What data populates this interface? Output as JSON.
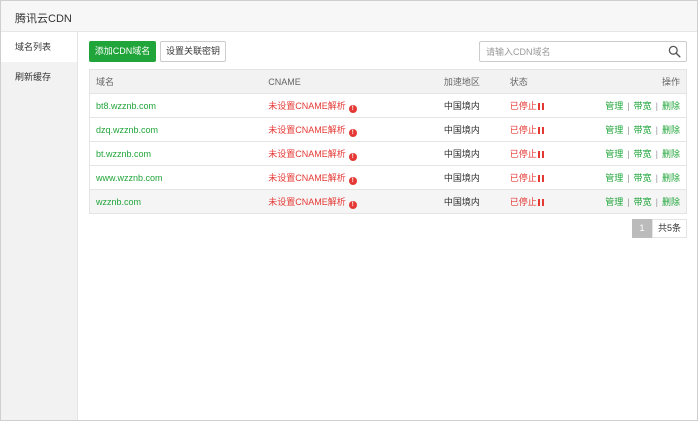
{
  "window": {
    "title": "腾讯云CDN"
  },
  "sidebar": {
    "items": [
      {
        "label": "域名列表"
      },
      {
        "label": "刷新缓存"
      }
    ]
  },
  "toolbar": {
    "add_button": "添加CDN域名",
    "key_button": "设置关联密钥",
    "search_placeholder": "请输入CDN域名",
    "search_icon": "search-icon"
  },
  "table": {
    "headers": {
      "domain": "域名",
      "cname": "CNAME",
      "region": "加速地区",
      "status": "状态",
      "ops": "操作"
    },
    "rows": [
      {
        "domain": "bt8.wzznb.com",
        "cname": "未设置CNAME解析",
        "region": "中国境内",
        "status": "已停止",
        "op_manage": "管理",
        "op_bandwidth": "带宽",
        "op_delete": "删除"
      },
      {
        "domain": "dzq.wzznb.com",
        "cname": "未设置CNAME解析",
        "region": "中国境内",
        "status": "已停止",
        "op_manage": "管理",
        "op_bandwidth": "带宽",
        "op_delete": "删除"
      },
      {
        "domain": "bt.wzznb.com",
        "cname": "未设置CNAME解析",
        "region": "中国境内",
        "status": "已停止",
        "op_manage": "管理",
        "op_bandwidth": "带宽",
        "op_delete": "删除"
      },
      {
        "domain": "www.wzznb.com",
        "cname": "未设置CNAME解析",
        "region": "中国境内",
        "status": "已停止",
        "op_manage": "管理",
        "op_bandwidth": "带宽",
        "op_delete": "删除"
      },
      {
        "domain": "wzznb.com",
        "cname": "未设置CNAME解析",
        "region": "中国境内",
        "status": "已停止",
        "op_manage": "管理",
        "op_bandwidth": "带宽",
        "op_delete": "删除"
      }
    ],
    "warn_glyph": "!",
    "separator": "|"
  },
  "pagination": {
    "current_page": "1",
    "total_text": "共5条"
  },
  "colors": {
    "accent_green": "#20a53a",
    "warning_red": "#e53935"
  }
}
